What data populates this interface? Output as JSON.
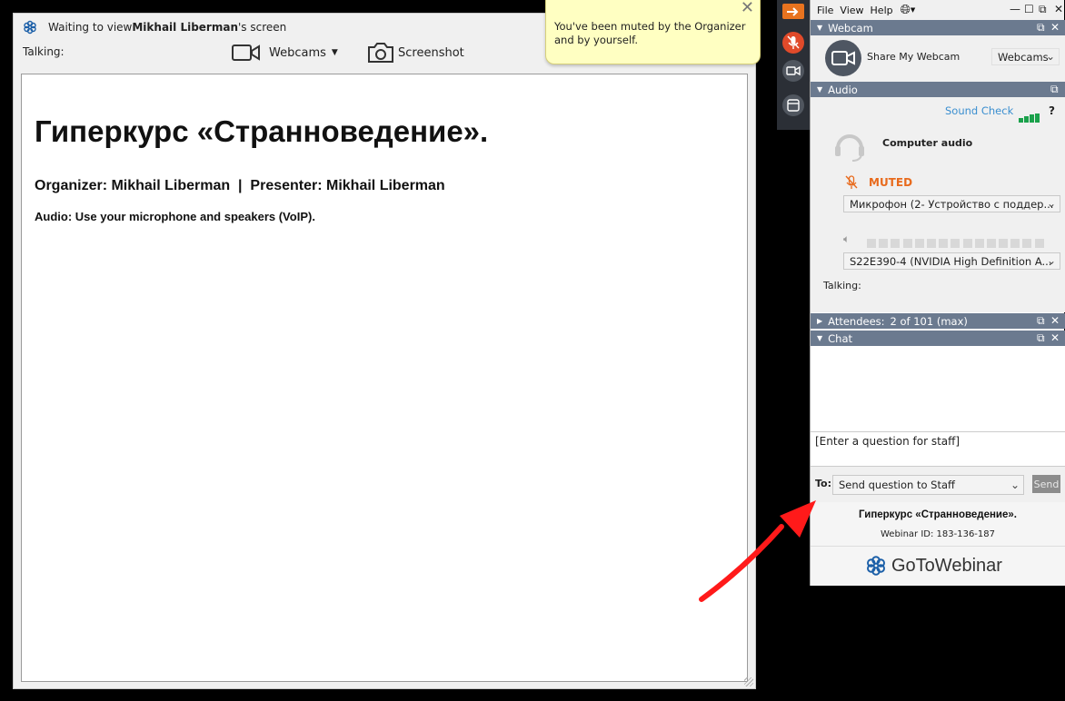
{
  "viewer": {
    "title_prefix": "Waiting to view ",
    "title_name": "Mikhail Liberman",
    "title_suffix": "'s screen",
    "talking_label": "Talking:",
    "webcams_label": "Webcams",
    "screenshot_label": "Screenshot",
    "screen_heading": "Гиперкурс «Странноведение».",
    "screen_org": "Organizer: Mikhail Liberman  |  Presenter: Mikhail Liberman",
    "screen_audio": "Audio: Use your microphone and speakers (VoIP)."
  },
  "tooltip": {
    "text": "You've been muted by the Organizer and by yourself."
  },
  "panel": {
    "menu": [
      "File",
      "View",
      "Help"
    ],
    "webcam": {
      "header": "Webcam",
      "share_label": "Share My Webcam",
      "dropdown": "Webcams"
    },
    "audio": {
      "header": "Audio",
      "sound_check": "Sound Check",
      "help": "?",
      "mode": "Computer audio",
      "muted": "MUTED",
      "mic_device": "Микрофон (2- Устройство с поддер...",
      "speaker_device": "S22E390-4 (NVIDIA High Definition A...",
      "talking_label": "Talking:"
    },
    "attendees": {
      "header": "Attendees:",
      "count": "2 of 101 (max)"
    },
    "chat": {
      "header": "Chat",
      "placeholder": "[Enter a question for staff]",
      "to_label": "To:",
      "to_value": "Send question to Staff",
      "send_label": "Send"
    },
    "footer": {
      "webinar_title": "Гиперкурс «Странноведение».",
      "webinar_id": "Webinar ID: 183-136-187",
      "brand": "GoToWebinar"
    }
  },
  "colors": {
    "accent_orange": "#e8731f",
    "header_blue": "#6b7a8f",
    "muted_orange": "#e86a1c",
    "sound_check": "#3b8fd0",
    "meter_green": "#1aa14b",
    "arrow_red": "#ff1a1a",
    "brand_blue": "#1b5fa8"
  }
}
